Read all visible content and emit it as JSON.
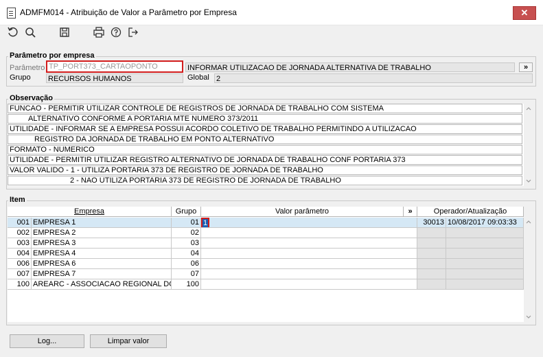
{
  "window": {
    "title": "ADMFM014 - Atribuição de Valor a Parâmetro por Empresa",
    "close": "✕"
  },
  "toolbar": {
    "icons": [
      "undo-icon",
      "search-icon",
      "save-icon",
      "print-icon",
      "help-icon",
      "exit-icon"
    ]
  },
  "param": {
    "group_title": "Parâmetro por empresa",
    "parametro_label": "Parâmetro",
    "parametro_value": "TP_PORT373_CARTAOPONTO",
    "descricao": "INFORMAR UTILIZACAO DE JORNADA ALTERNATIVA DE TRABALHO",
    "more_btn": "»",
    "grupo_label": "Grupo",
    "grupo_value": "RECURSOS HUMANOS",
    "global_label": "Global",
    "global_value": "2"
  },
  "obs": {
    "group_title": "Observação",
    "lines": [
      "FUNCAO - PERMITIR UTILIZAR CONTROLE DE REGISTROS DE JORNADA DE TRABALHO COM SISTEMA",
      "ALTERNATIVO CONFORME A PORTARIA MTE NUMERO 373/2011",
      "UTILIDADE - INFORMAR SE A EMPRESA POSSUI ACORDO COLETIVO DE TRABALHO PERMITINDO A UTILIZACAO",
      "REGISTRO DA JORNADA DE TRABALHO EM PONTO ALTERNATIVO",
      "FORMATO - NUMERICO",
      "UTILIDADE - PERMITIR UTILIZAR REGISTRO ALTERNATIVO DE JORNADA DE TRABALHO CONF PORTARIA 373",
      "VALOR VALIDO - 1 - UTILIZA PORTARIA 373 DE REGISTRO DE JORNADA DE TRABALHO",
      "2 - NAO UTILIZA PORTARIA 373 DE REGISTRO DE JORNADA DE TRABALHO"
    ]
  },
  "item": {
    "group_title": "Item",
    "headers": {
      "empresa": "Empresa",
      "grupo": "Grupo",
      "valor": "Valor parâmetro",
      "more": "»",
      "operador": "Operador/Atualização"
    },
    "rows": [
      {
        "cod": "001",
        "empresa": "EMPRESA 1",
        "grupo": "01",
        "valor": "1",
        "operador": "30013",
        "data": "10/08/2017 09:03:33"
      },
      {
        "cod": "002",
        "empresa": "EMPRESA 2",
        "grupo": "02",
        "valor": "",
        "operador": "",
        "data": ""
      },
      {
        "cod": "003",
        "empresa": "EMPRESA 3",
        "grupo": "03",
        "valor": "",
        "operador": "",
        "data": ""
      },
      {
        "cod": "004",
        "empresa": "EMPRESA 4",
        "grupo": "04",
        "valor": "",
        "operador": "",
        "data": ""
      },
      {
        "cod": "006",
        "empresa": "EMPRESA 6",
        "grupo": "06",
        "valor": "",
        "operador": "",
        "data": ""
      },
      {
        "cod": "007",
        "empresa": "EMPRESA 7",
        "grupo": "07",
        "valor": "",
        "operador": "",
        "data": ""
      },
      {
        "cod": "100",
        "empresa": "AREARC - ASSOCIACAO REGIONAL DOS",
        "grupo": "100",
        "valor": "",
        "operador": "",
        "data": ""
      }
    ]
  },
  "buttons": {
    "log": "Log...",
    "limpar": "Limpar valor"
  }
}
